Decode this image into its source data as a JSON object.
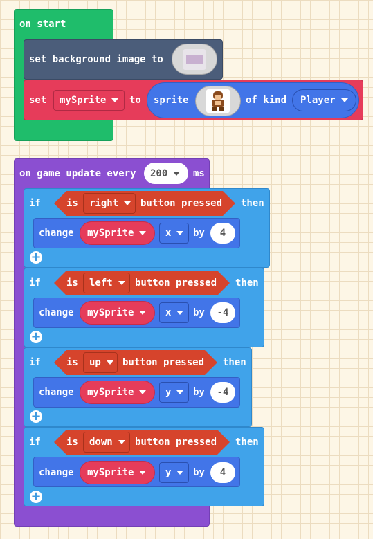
{
  "on_start": {
    "label": "on start",
    "bg_block": {
      "label": "set background image to"
    },
    "set_block": {
      "set": "set",
      "var": "mySprite",
      "to": "to",
      "sprite": "sprite",
      "of_kind": "of kind",
      "kind": "Player"
    }
  },
  "game_update": {
    "label": "on game update every",
    "interval": "200",
    "unit": "ms",
    "ifs": [
      {
        "if": "if",
        "is": "is",
        "button": "right",
        "pressed": "button pressed",
        "then": "then",
        "change": "change",
        "var": "mySprite",
        "axis": "x",
        "by": "by",
        "value": "4"
      },
      {
        "if": "if",
        "is": "is",
        "button": "left",
        "pressed": "button pressed",
        "then": "then",
        "change": "change",
        "var": "mySprite",
        "axis": "x",
        "by": "by",
        "value": "-4"
      },
      {
        "if": "if",
        "is": "is",
        "button": "up",
        "pressed": "button pressed",
        "then": "then",
        "change": "change",
        "var": "mySprite",
        "axis": "y",
        "by": "by",
        "value": "-4"
      },
      {
        "if": "if",
        "is": "is",
        "button": "down",
        "pressed": "button pressed",
        "then": "then",
        "change": "change",
        "var": "mySprite",
        "axis": "y",
        "by": "by",
        "value": "4"
      }
    ]
  },
  "colors": {
    "scene": "#1fbd6b",
    "scene_dark": "#4b5d7a",
    "sprites": "#e63c5a",
    "sprites_field": "#4275e8",
    "loops": "#8b4fd1",
    "logic": "#40a3ea",
    "controller": "#d6442c"
  }
}
